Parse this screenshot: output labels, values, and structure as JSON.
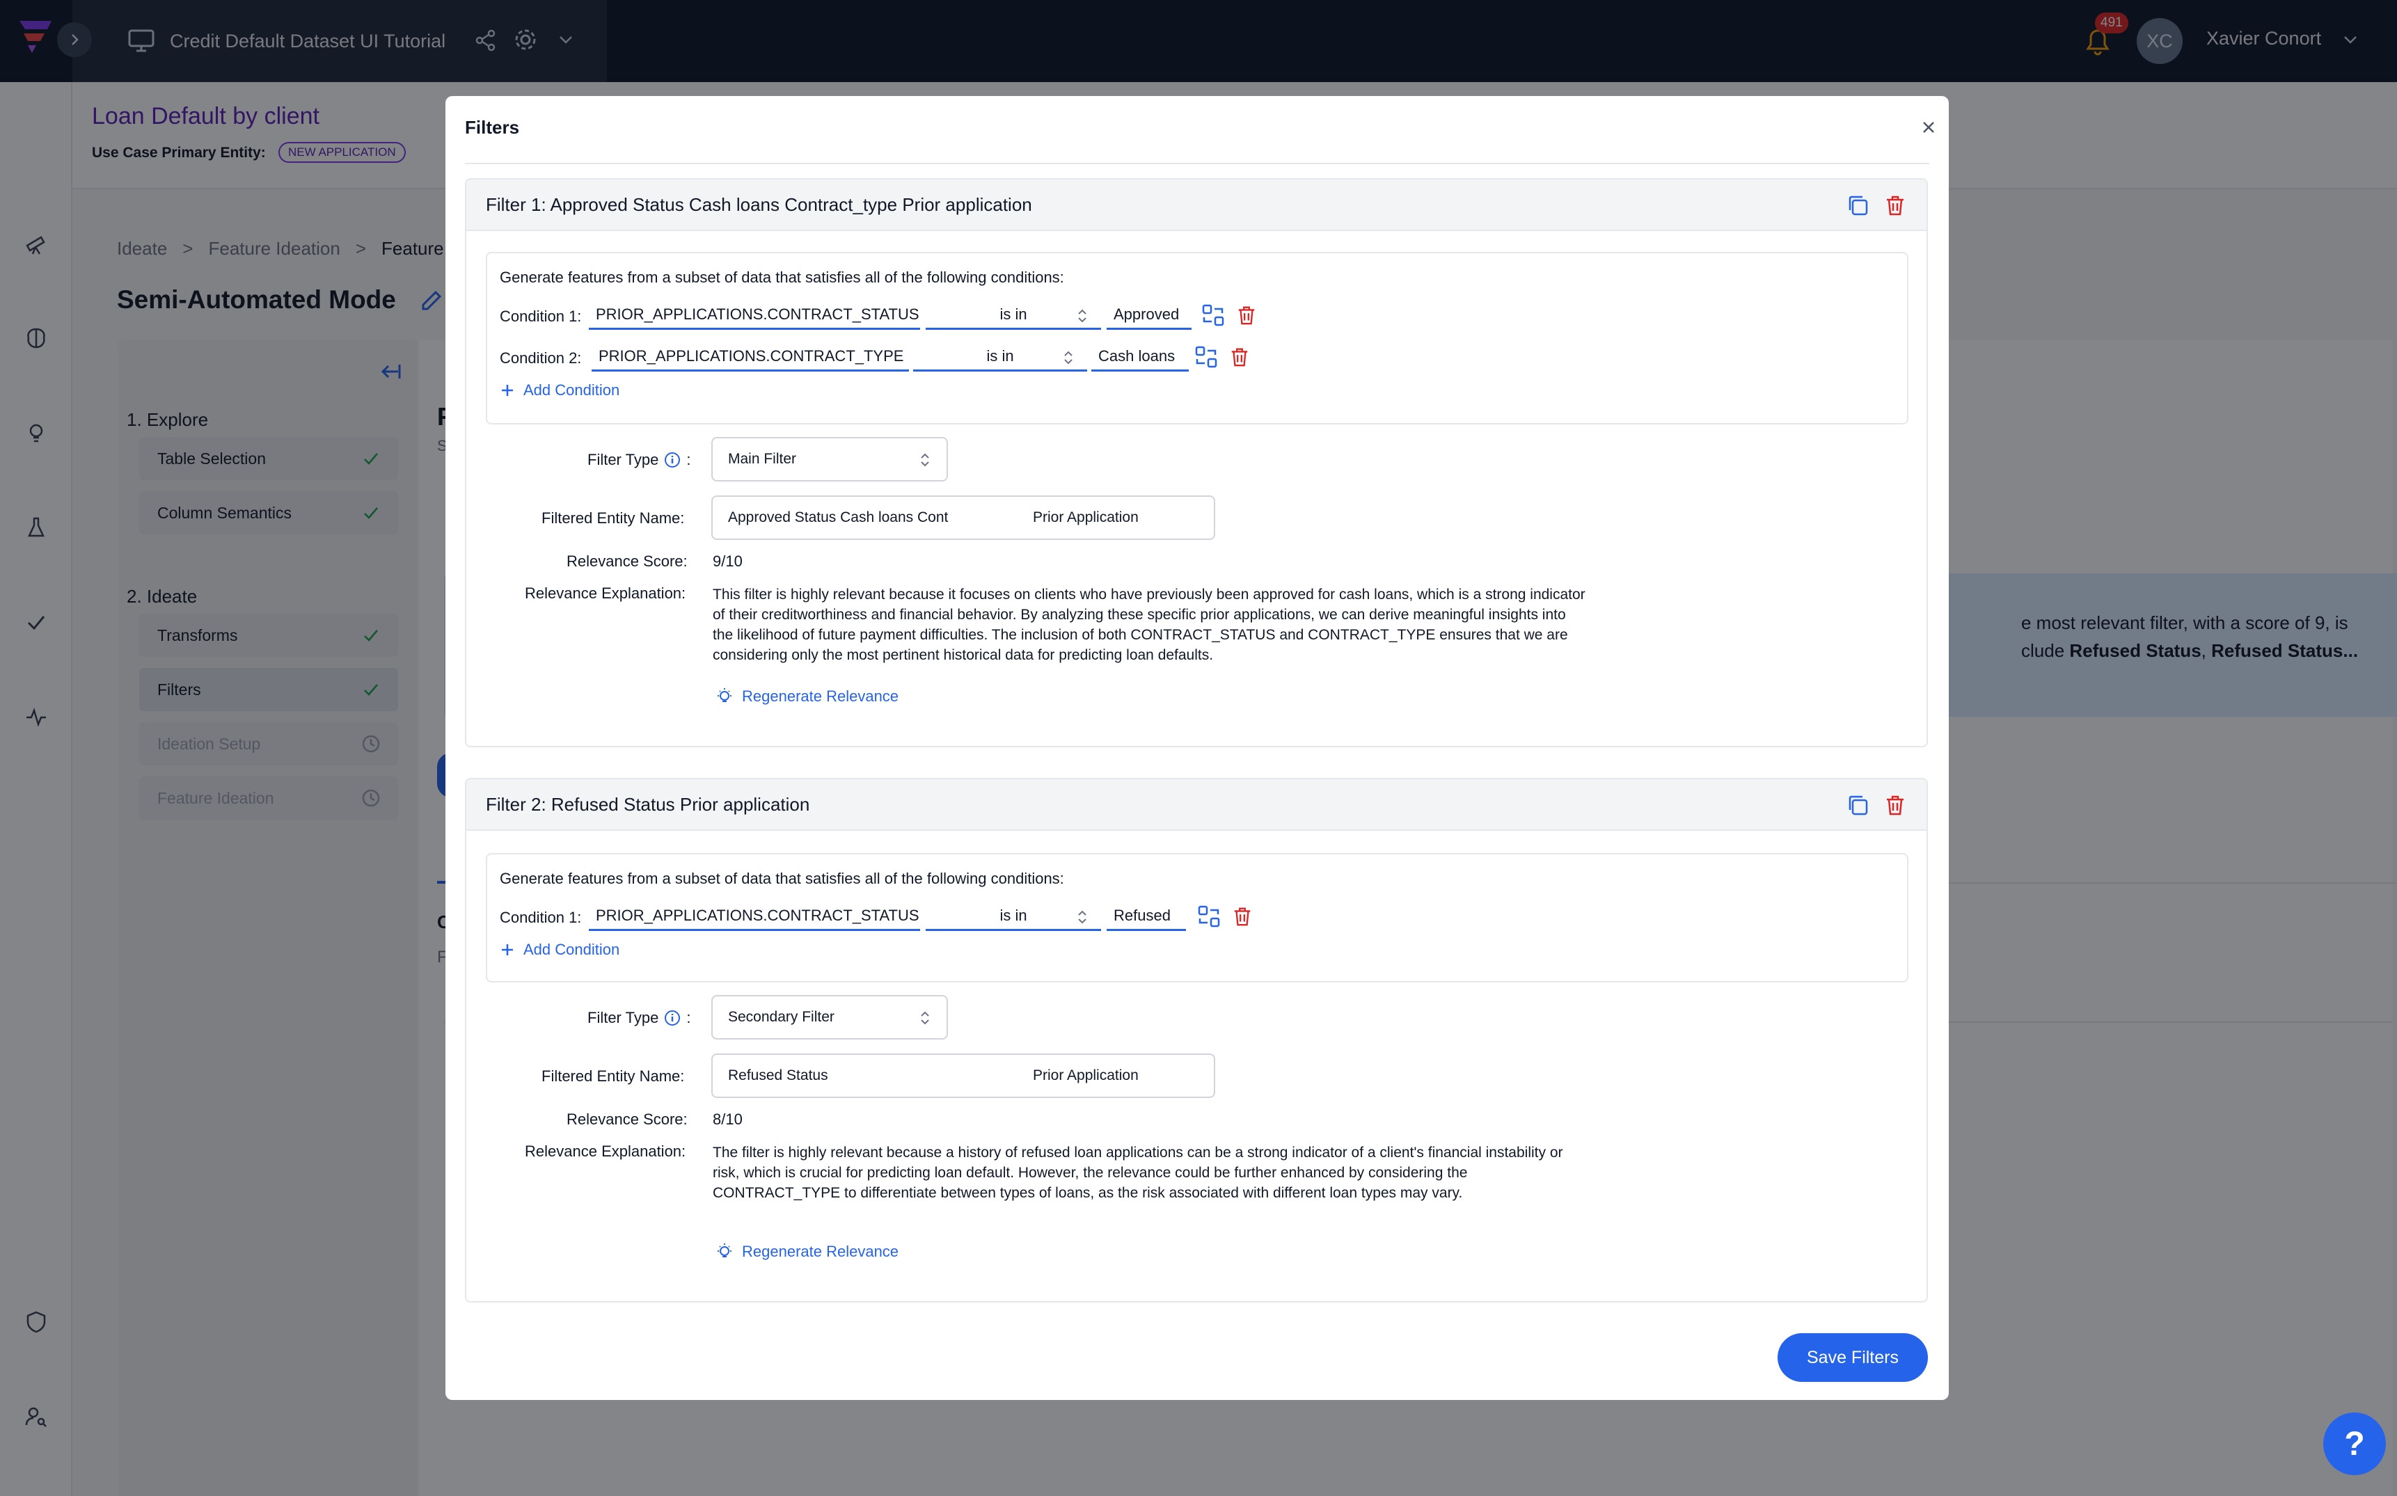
{
  "topbar": {
    "project_title": "Credit Default Dataset UI Tutorial",
    "notification_count": "491",
    "user_initials": "XC",
    "user_name": "Xavier Conort"
  },
  "page": {
    "title": "Loan Default by client",
    "primary_entity_label": "Use Case Primary Entity:",
    "primary_entity_badge": "NEW APPLICATION",
    "breadcrumb": [
      "Ideate",
      "Feature Ideation",
      "Feature"
    ],
    "mode_title": "Semi-Automated Mode",
    "background_text_1": "e most relevant filter, with a score of 9, is",
    "background_text_2_prefix": "clude ",
    "background_text_2_bold1": "Refused Status",
    "background_text_2_sep": ", ",
    "background_text_2_bold2": "Refused Status...",
    "background_fragments": [
      "F",
      "S",
      "C",
      "F"
    ]
  },
  "steps": {
    "section1": "1. Explore",
    "section2": "2. Ideate",
    "items": [
      {
        "label": "Table Selection",
        "state": "done"
      },
      {
        "label": "Column Semantics",
        "state": "done"
      },
      {
        "label": "Transforms",
        "state": "done"
      },
      {
        "label": "Filters",
        "state": "done"
      },
      {
        "label": "Ideation Setup",
        "state": "pending"
      },
      {
        "label": "Feature Ideation",
        "state": "pending"
      }
    ]
  },
  "modal": {
    "title": "Filters",
    "save_label": "Save Filters",
    "filters": [
      {
        "title": "Filter 1: Approved Status Cash loans Contract_type Prior application",
        "conditions_intro": "Generate features from a subset of data that satisfies all of the following conditions:",
        "conditions": [
          {
            "label": "Condition 1:",
            "column": "PRIOR_APPLICATIONS.CONTRACT_STATUS",
            "operator": "is in",
            "value": "Approved"
          },
          {
            "label": "Condition 2:",
            "column": "PRIOR_APPLICATIONS.CONTRACT_TYPE",
            "operator": "is in",
            "value": "Cash loans"
          }
        ],
        "add_condition": "Add Condition",
        "filter_type_label": "Filter Type",
        "filter_type": "Main Filter",
        "entity_name_label": "Filtered Entity Name:",
        "entity_name": "Approved Status Cash loans Cont",
        "entity_suffix": "Prior Application",
        "relevance_score_label": "Relevance Score:",
        "relevance_score": "9/10",
        "relevance_explanation_label": "Relevance Explanation:",
        "relevance_explanation": "This filter is highly relevant because it focuses on clients who have previously been approved for cash loans, which is a strong indicator of their creditworthiness and financial behavior. By analyzing these specific prior applications, we can derive meaningful insights into the likelihood of future payment difficulties. The inclusion of both CONTRACT_STATUS and CONTRACT_TYPE ensures that we are considering only the most pertinent historical data for predicting loan defaults.",
        "regenerate": "Regenerate Relevance"
      },
      {
        "title": "Filter 2: Refused Status Prior application",
        "conditions_intro": "Generate features from a subset of data that satisfies all of the following conditions:",
        "conditions": [
          {
            "label": "Condition 1:",
            "column": "PRIOR_APPLICATIONS.CONTRACT_STATUS",
            "operator": "is in",
            "value": "Refused"
          }
        ],
        "add_condition": "Add Condition",
        "filter_type_label": "Filter Type",
        "filter_type": "Secondary Filter",
        "entity_name_label": "Filtered Entity Name:",
        "entity_name": "Refused Status",
        "entity_suffix": "Prior Application",
        "relevance_score_label": "Relevance Score:",
        "relevance_score": "8/10",
        "relevance_explanation_label": "Relevance Explanation:",
        "relevance_explanation": "The filter is highly relevant because a history of refused loan applications can be a strong indicator of a client's financial instability or risk, which is crucial for predicting loan default. However, the relevance could be further enhanced by considering the CONTRACT_TYPE to differentiate between types of loans, as the risk associated with different loan types may vary.",
        "regenerate": "Regenerate Relevance"
      }
    ]
  },
  "colors": {
    "accent": "#2563eb",
    "danger": "#dc2626",
    "brand_purple": "#5b21b6",
    "topbar": "#0f172a"
  },
  "help_label": "?"
}
